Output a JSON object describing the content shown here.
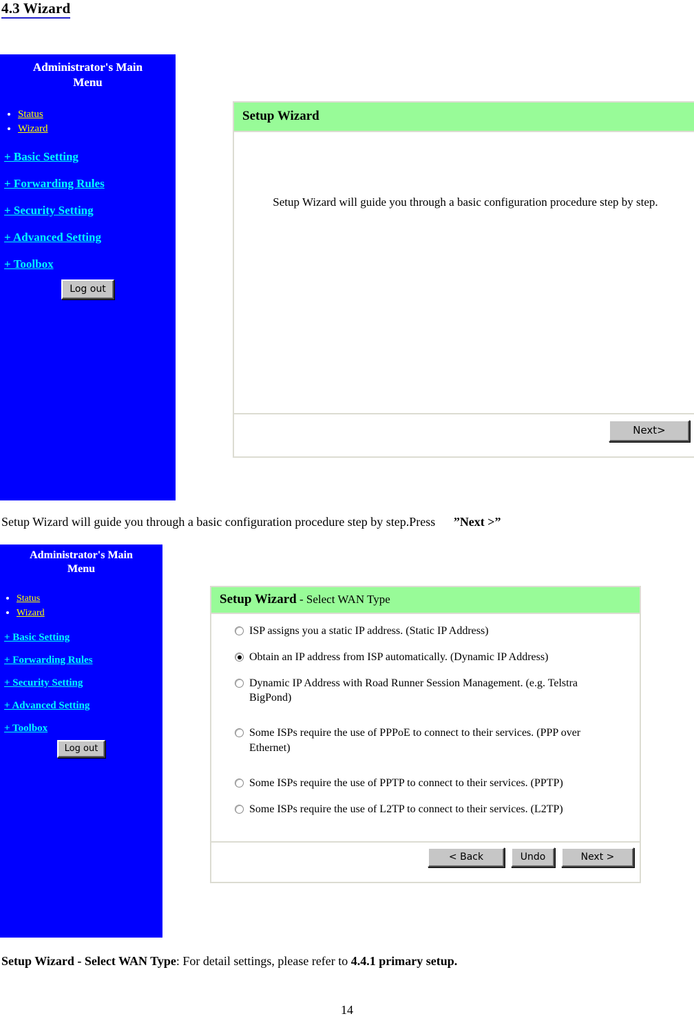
{
  "document": {
    "section_heading": "4.3 Wizard",
    "page_number": "14"
  },
  "colors": {
    "sidebar_bg": "#0000ff",
    "panel_header_bg": "#98fb98",
    "link_primary": "#ffff00",
    "link_secondary": "#00ffff",
    "heading_underline": "#2222cc",
    "button_face": "#c6c6c6",
    "panel_border": "#dcdcd2"
  },
  "sidebar": {
    "title_line1": "Administrator's Main",
    "title_line2": "Menu",
    "bullet_items": [
      {
        "label": "Status"
      },
      {
        "label": "Wizard"
      }
    ],
    "expandable_items": [
      {
        "label": "+ Basic Setting"
      },
      {
        "label": "+ Forwarding Rules"
      },
      {
        "label": "+ Security Setting"
      },
      {
        "label": "+ Advanced Setting"
      },
      {
        "label": "+ Toolbox"
      }
    ],
    "logout_label": "Log out"
  },
  "screenshot1": {
    "header_title": "Setup Wizard",
    "body_text": "Setup Wizard will guide you through a basic configuration procedure step by step.",
    "next_button": "Next>"
  },
  "caption1": {
    "text_plain": "Setup Wizard will guide you through a basic configuration procedure step by step.Press",
    "text_bold": "”Next >”"
  },
  "screenshot2": {
    "header_title": "Setup Wizard",
    "header_subtitle": " - Select WAN Type",
    "options": [
      {
        "label": "ISP assigns you a static IP address. (Static IP Address)",
        "selected": false
      },
      {
        "label": "Obtain an IP address from ISP automatically. (Dynamic IP Address)",
        "selected": true
      },
      {
        "label": "Dynamic IP Address with Road Runner Session Management. (e.g. Telstra BigPond)",
        "selected": false
      },
      {
        "label": "Some ISPs require the use of PPPoE to connect to their services. (PPP over Ethernet)",
        "selected": false
      },
      {
        "label": "Some ISPs require the use of PPTP to connect to their services. (PPTP)",
        "selected": false
      },
      {
        "label": "Some ISPs require the use of L2TP to connect to their services. (L2TP)",
        "selected": false
      }
    ],
    "buttons": {
      "back": "< Back",
      "undo": "Undo",
      "next": "Next >"
    }
  },
  "caption2": {
    "text_bold_lead": "Setup Wizard - Select WAN Type",
    "text_plain": ": For detail settings, please refer to ",
    "text_bold_tail": "4.4.1 primary setup."
  }
}
